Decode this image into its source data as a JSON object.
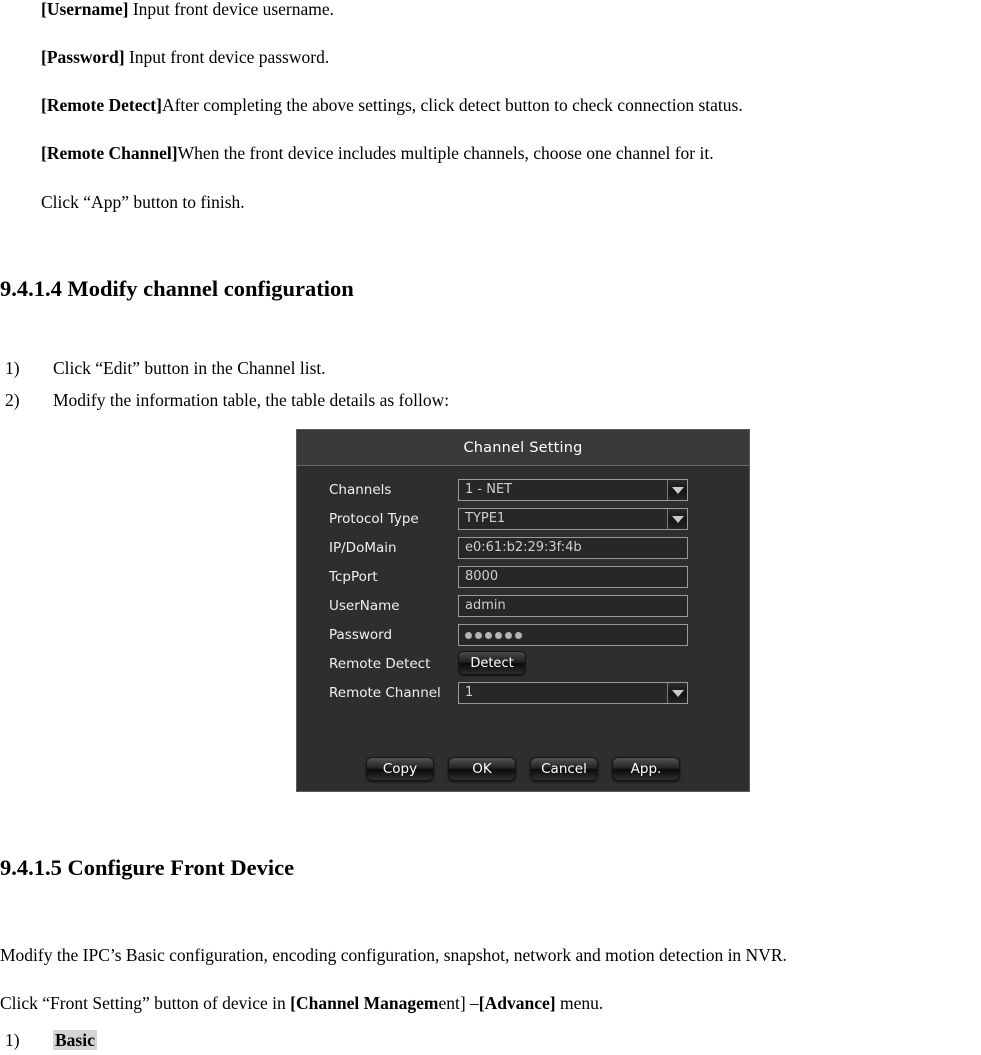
{
  "doc": {
    "paragraphs": {
      "username": {
        "bold": "[Username]",
        "rest": " Input front device username."
      },
      "password": {
        "bold": "[Password]",
        "rest": " Input front device password."
      },
      "remote_detect": {
        "bold": "[Remote Detect]",
        "rest": "After completing the above settings, click detect button to check connection status."
      },
      "remote_channel": {
        "bold": "[Remote Channel]",
        "rest": "When the front device includes multiple channels, choose one channel for it."
      },
      "click_app": "Click “App” button to finish.",
      "modify_ipc": "Modify the IPC’s Basic configuration, encoding configuration, snapshot, network and motion detection in NVR.",
      "front_setting_pre": "Click “Front Setting” button of device in ",
      "front_setting_b1": "[Channel Managem",
      "front_setting_mid": "ent] –",
      "front_setting_b2": "[Advance]",
      "front_setting_post": " menu."
    },
    "headings": {
      "s9414": "9.4.1.4 Modify channel configuration",
      "s9415": "9.4.1.5 Configure Front Device"
    },
    "list": {
      "item1_num": "1)",
      "item1_text": "Click “Edit” button in the Channel list.",
      "item2_num": "2)",
      "item2_text": "Modify the information table, the table details as follow:",
      "basic_num": "1)",
      "basic_text": "Basic"
    }
  },
  "dialog": {
    "title": "Channel Setting",
    "fields": [
      {
        "label": "Channels",
        "value": "1 - NET",
        "type": "dropdown"
      },
      {
        "label": "Protocol Type",
        "value": "TYPE1",
        "type": "dropdown"
      },
      {
        "label": "IP/DoMain",
        "value": "e0:61:b2:29:3f:4b",
        "type": "text"
      },
      {
        "label": "TcpPort",
        "value": "8000",
        "type": "text"
      },
      {
        "label": "UserName",
        "value": "admin",
        "type": "text"
      },
      {
        "label": "Password",
        "value": "●●●●●●",
        "type": "password",
        "dots": 6
      },
      {
        "label": "Remote Detect",
        "value": "Detect",
        "type": "button"
      },
      {
        "label": "Remote Channel",
        "value": "1",
        "type": "dropdown"
      }
    ],
    "footer_buttons": [
      {
        "label": "Copy"
      },
      {
        "label": "OK"
      },
      {
        "label": "Cancel"
      },
      {
        "label": "App."
      }
    ],
    "colors": {
      "window_bg": "#2e2e2e",
      "titlebar_bg": "#3a3a3a",
      "field_bg": "#272727",
      "field_border": "#9a9a9a",
      "text": "#f0f0f0",
      "value_text": "#cfcfcf"
    }
  }
}
